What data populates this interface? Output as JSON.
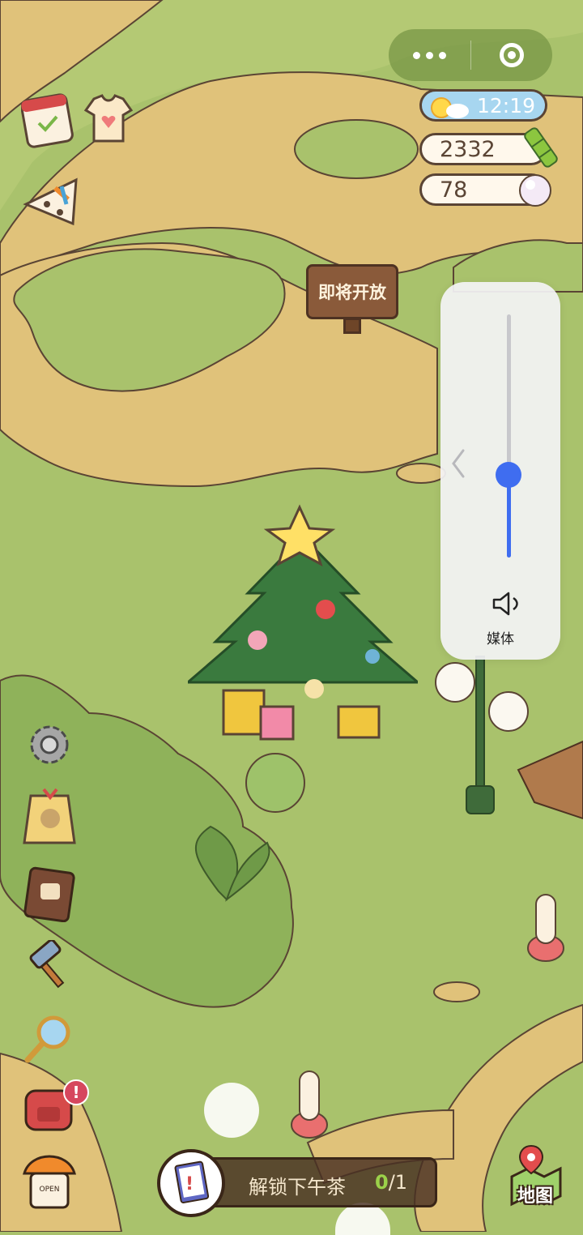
{
  "capsule": {
    "more_icon": "more-dots-icon",
    "close_icon": "target-circle-icon"
  },
  "stats": {
    "time": "12:19",
    "weather_icon": "sun-cloud-icon",
    "bamboo": "2332",
    "bamboo_icon": "bamboo-icon",
    "pearls": "78",
    "pearl_icon": "pearl-icon"
  },
  "sign": {
    "label": "即将开放"
  },
  "volume": {
    "label": "媒体",
    "level": 0.34,
    "collapse_icon": "chevron-left-icon",
    "speaker_icon": "speaker-icon"
  },
  "left_menu": [
    {
      "name": "calendar-icon"
    },
    {
      "name": "tshirt-icon"
    },
    {
      "name": "pizza-icon"
    },
    {
      "name": "gear-icon"
    },
    {
      "name": "gift-tag-icon"
    },
    {
      "name": "recipe-book-icon"
    },
    {
      "name": "hammer-icon"
    },
    {
      "name": "magnifier-icon"
    },
    {
      "name": "backpack-icon"
    },
    {
      "name": "shop-house-icon"
    }
  ],
  "backpack_badge": "!",
  "shop_sign": "OPEN",
  "task": {
    "label": "解锁下午茶",
    "progress_done": "0",
    "progress_total": "/1"
  },
  "map_button": {
    "label": "地图"
  },
  "colors": {
    "grass": "#a9c26c",
    "path": "#e0c27a",
    "accent_blue": "#3f6df0",
    "wood": "#8a5a3a"
  }
}
